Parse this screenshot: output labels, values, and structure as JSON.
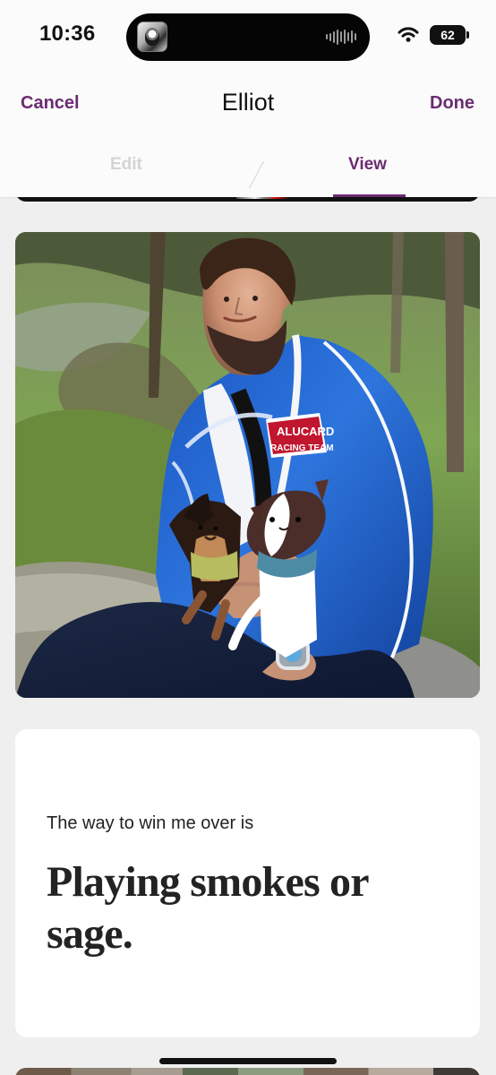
{
  "status_bar": {
    "time": "10:36",
    "battery": "62"
  },
  "header": {
    "cancel_label": "Cancel",
    "title": "Elliot",
    "done_label": "Done"
  },
  "tabs": [
    {
      "label": "Edit",
      "active": false
    },
    {
      "label": "View",
      "active": true
    }
  ],
  "prompt": {
    "question": "The way to win me over is",
    "answer": "Playing smokes or sage."
  },
  "photo": {
    "jacket_text_line1": "ALUCARD",
    "jacket_text_line2": "RACING TEAM"
  },
  "colors": {
    "accent": "#6b2c72",
    "background": "#efefef",
    "surface": "#ffffff",
    "text": "#111111"
  },
  "icons": {
    "wifi": "wifi-icon",
    "battery": "battery-icon"
  }
}
